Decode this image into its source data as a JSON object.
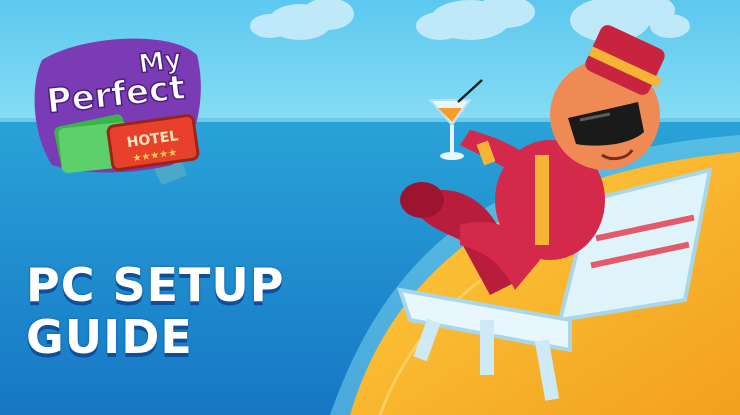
{
  "logo": {
    "line1": "My",
    "line2": "Perfect",
    "badge": "HOTEL",
    "stars": "★★★★★"
  },
  "headline": {
    "line1": "PC SETUP",
    "line2": "GUIDE"
  },
  "colors": {
    "sky": "#6fd2f2",
    "sea": "#1c8fd1",
    "sand": "#f7b82e",
    "logo_purple": "#7b3bb5",
    "badge_red": "#e7412c",
    "title_shadow": "#0d4f9a"
  }
}
